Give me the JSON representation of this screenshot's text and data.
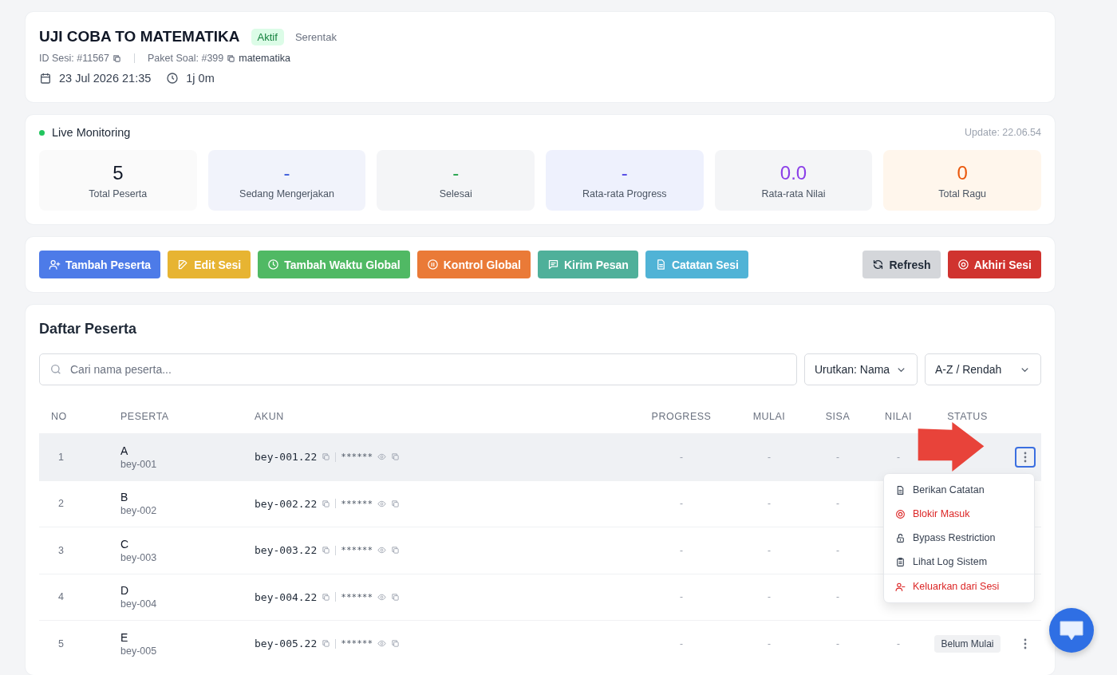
{
  "header": {
    "title": "UJI COBA TO MATEMATIKA",
    "status_badge": "Aktif",
    "mode": "Serentak",
    "session_id": "ID Sesi: #11567",
    "package": "Paket Soal: #399",
    "package_name": "matematika",
    "date": "23 Jul 2026 21:35",
    "duration": "1j 0m"
  },
  "monitoring": {
    "label": "Live Monitoring",
    "live": true,
    "update": "Update: 22.06.54",
    "stats": [
      {
        "value": "5",
        "label": "Total Peserta",
        "kind": "neutral"
      },
      {
        "value": "-",
        "label": "Sedang Mengerjakan",
        "kind": "blue"
      },
      {
        "value": "-",
        "label": "Selesai",
        "kind": "green"
      },
      {
        "value": "-",
        "label": "Rata-rata Progress",
        "kind": "indigo"
      },
      {
        "value": "0.0",
        "label": "Rata-rata Nilai",
        "kind": "purple"
      },
      {
        "value": "0",
        "label": "Total Ragu",
        "kind": "orange"
      }
    ]
  },
  "actions": {
    "left": [
      {
        "label": "Tambah Peserta",
        "kind": "add-user"
      },
      {
        "label": "Edit Sesi",
        "kind": "edit"
      },
      {
        "label": "Tambah Waktu Global",
        "kind": "time"
      },
      {
        "label": "Kontrol Global",
        "kind": "pause"
      },
      {
        "label": "Kirim Pesan",
        "kind": "message"
      },
      {
        "label": "Catatan Sesi",
        "kind": "note"
      }
    ],
    "right": [
      {
        "label": "Refresh",
        "kind": "refresh"
      },
      {
        "label": "Akhiri Sesi",
        "kind": "stop"
      }
    ]
  },
  "participants": {
    "title": "Daftar Peserta",
    "search": {
      "placeholder": "Cari nama peserta..."
    },
    "sort_by": "Urutkan: Nama",
    "sort_order": "A-Z / Rendah",
    "columns": [
      "NO",
      "PESERTA",
      "AKUN",
      "PROGRESS",
      "MULAI",
      "SISA",
      "NILAI",
      "STATUS"
    ],
    "rows": [
      {
        "no": "1",
        "name": "A",
        "username": "bey-001",
        "account": "bey-001.22",
        "password": "******",
        "progress": "-",
        "start": "-",
        "remaining": "-",
        "score": "-",
        "selected": true,
        "menu_button": true
      },
      {
        "no": "2",
        "name": "B",
        "username": "bey-002",
        "account": "bey-002.22",
        "password": "******",
        "progress": "-",
        "start": "-",
        "remaining": "-",
        "selected": false,
        "menu_button": false
      },
      {
        "no": "3",
        "name": "C",
        "username": "bey-003",
        "account": "bey-003.22",
        "password": "******",
        "progress": "-",
        "start": "-",
        "remaining": "-",
        "selected": false,
        "menu_button": false
      },
      {
        "no": "4",
        "name": "D",
        "username": "bey-004",
        "account": "bey-004.22",
        "password": "******",
        "progress": "-",
        "start": "-",
        "remaining": "-",
        "selected": false,
        "menu_button": false
      },
      {
        "no": "5",
        "name": "E",
        "username": "bey-005",
        "account": "bey-005.22",
        "password": "******",
        "progress": "-",
        "start": "-",
        "remaining": "-",
        "score": "-",
        "status": "Belum Mulai",
        "selected": false,
        "menu_button": true
      }
    ],
    "menu": [
      {
        "label": "Berikan Catatan",
        "kind": "note",
        "danger": false,
        "divider_before": false
      },
      {
        "label": "Blokir Masuk",
        "kind": "block",
        "danger": true,
        "divider_before": false
      },
      {
        "label": "Bypass Restriction",
        "kind": "unlock",
        "danger": false,
        "divider_before": false
      },
      {
        "label": "Lihat Log Sistem",
        "kind": "clipboard",
        "danger": false,
        "divider_before": false
      },
      {
        "label": "Keluarkan dari Sesi",
        "kind": "remove-user",
        "danger": true,
        "divider_before": true
      }
    ]
  }
}
